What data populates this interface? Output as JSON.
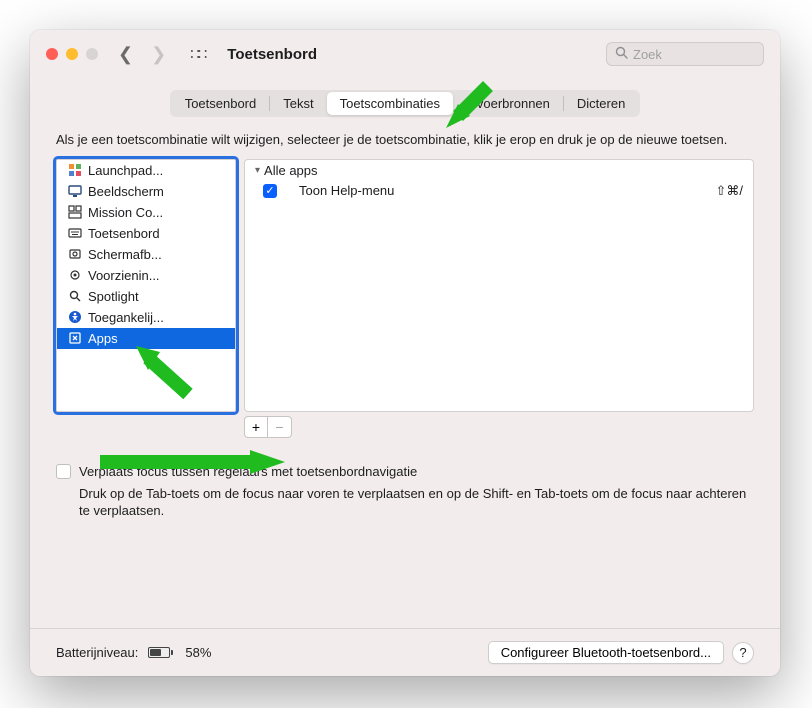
{
  "titlebar": {
    "title": "Toetsenbord",
    "search_placeholder": "Zoek"
  },
  "tabs": [
    "Toetsenbord",
    "Tekst",
    "Toetscombinaties",
    "Invoerbronnen",
    "Dicteren"
  ],
  "active_tab": "Toetscombinaties",
  "description": "Als je een toetscombinatie wilt wijzigen, selecteer je de toetscombinatie, klik je erop en druk je op de nieuwe toetsen.",
  "categories": [
    {
      "label": "Launchpad...",
      "icon": "launchpad"
    },
    {
      "label": "Beeldscherm",
      "icon": "display"
    },
    {
      "label": "Mission Co...",
      "icon": "mission"
    },
    {
      "label": "Toetsenbord",
      "icon": "keyboard"
    },
    {
      "label": "Schermafb...",
      "icon": "screenshot"
    },
    {
      "label": "Voorzienin...",
      "icon": "services"
    },
    {
      "label": "Spotlight",
      "icon": "spotlight"
    },
    {
      "label": "Toegankelij...",
      "icon": "accessibility"
    },
    {
      "label": "Apps",
      "icon": "apps",
      "selected": true
    }
  ],
  "shortcuts": {
    "group": "Alle apps",
    "items": [
      {
        "enabled": true,
        "name": "Toon Help-menu",
        "shortcut": "⇧⌘/"
      }
    ]
  },
  "focus_checkbox": {
    "label": "Verplaats focus tussen regelaars met toetsenbordnavigatie",
    "help": "Druk op de Tab-toets om de focus naar voren te verplaatsen en op de Shift- en Tab-toets om de focus naar achteren te verplaatsen."
  },
  "footer": {
    "battery_label": "Batterijniveau:",
    "battery_pct": "58%",
    "configure_btn": "Configureer Bluetooth-toetsenbord..."
  }
}
